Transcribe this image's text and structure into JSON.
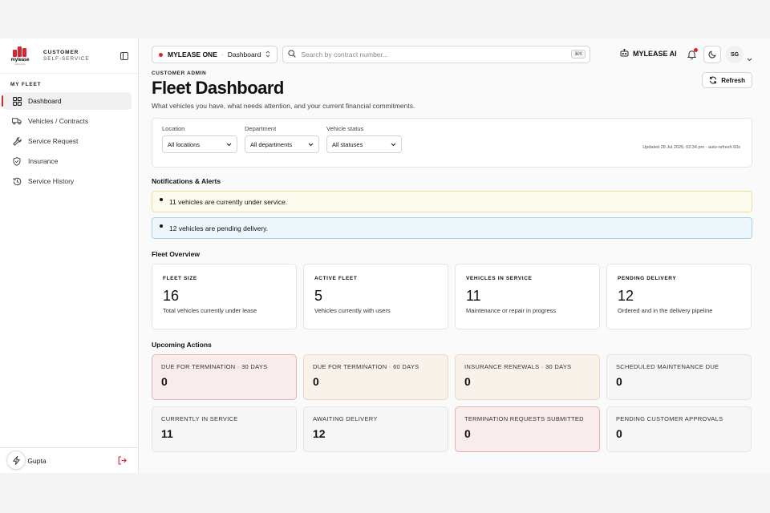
{
  "brand": {
    "logo_word": "mylease",
    "logo_sub": "official site",
    "line1": "CUSTOMER",
    "line2": "SELF-SERVICE"
  },
  "sidebar": {
    "section": "MY FLEET",
    "items": [
      {
        "label": "Dashboard",
        "icon": "dashboard-grid-icon",
        "active": true
      },
      {
        "label": "Vehicles / Contracts",
        "icon": "truck-icon",
        "active": false
      },
      {
        "label": "Service Request",
        "icon": "wrench-icon",
        "active": false
      },
      {
        "label": "Insurance",
        "icon": "shield-icon",
        "active": false
      },
      {
        "label": "Service History",
        "icon": "history-icon",
        "active": false
      }
    ],
    "user_name": "S. Gupta"
  },
  "topbar": {
    "org": "MYLEASE ONE",
    "page": "Dashboard",
    "search_placeholder": "Search by contract number...",
    "search_shortcut": "⌘K",
    "ai_label": "MYLEASE AI",
    "avatar_initials": "SG"
  },
  "header": {
    "eyebrow": "CUSTOMER ADMIN",
    "title": "Fleet Dashboard",
    "subtitle": "What vehicles you have, what needs attention, and your current financial commitments.",
    "refresh_label": "Refresh"
  },
  "filters": {
    "location": {
      "label": "Location",
      "value": "All locations"
    },
    "department": {
      "label": "Department",
      "value": "All departments"
    },
    "status": {
      "label": "Vehicle status",
      "value": "All statuses"
    },
    "updated": "Updated 28 Jul 2026, 02:34 pm · auto-refresh 60s"
  },
  "alerts": {
    "heading": "Notifications & Alerts",
    "items": [
      {
        "text": "11 vehicles are currently under service.",
        "kind": "warning"
      },
      {
        "text": "12 vehicles are pending delivery.",
        "kind": "info"
      }
    ]
  },
  "overview": {
    "heading": "Fleet Overview",
    "cards": [
      {
        "label": "FLEET SIZE",
        "value": "16",
        "desc": "Total vehicles currently under lease"
      },
      {
        "label": "ACTIVE FLEET",
        "value": "5",
        "desc": "Vehicles currently with users"
      },
      {
        "label": "VEHICLES IN SERVICE",
        "value": "11",
        "desc": "Maintenance or repair in progress"
      },
      {
        "label": "PENDING DELIVERY",
        "value": "12",
        "desc": "Ordered and in the delivery pipeline"
      }
    ]
  },
  "actions": {
    "heading": "Upcoming Actions",
    "cards": [
      {
        "label": "DUE FOR TERMINATION · 30 DAYS",
        "value": "0",
        "tone": "red"
      },
      {
        "label": "DUE FOR TERMINATION · 60 DAYS",
        "value": "0",
        "tone": "tan"
      },
      {
        "label": "INSURANCE RENEWALS · 30 DAYS",
        "value": "0",
        "tone": "tan"
      },
      {
        "label": "SCHEDULED MAINTENANCE DUE",
        "value": "0",
        "tone": "neutral"
      },
      {
        "label": "CURRENTLY IN SERVICE",
        "value": "11",
        "tone": "neutral"
      },
      {
        "label": "AWAITING DELIVERY",
        "value": "12",
        "tone": "neutral"
      },
      {
        "label": "TERMINATION REQUESTS SUBMITTED",
        "value": "0",
        "tone": "red"
      },
      {
        "label": "PENDING CUSTOMER APPROVALS",
        "value": "0",
        "tone": "neutral"
      }
    ]
  },
  "colors": {
    "brand_red": "#d7262f",
    "warning_bg": "#fdfaee",
    "info_bg": "#eef7fb"
  }
}
